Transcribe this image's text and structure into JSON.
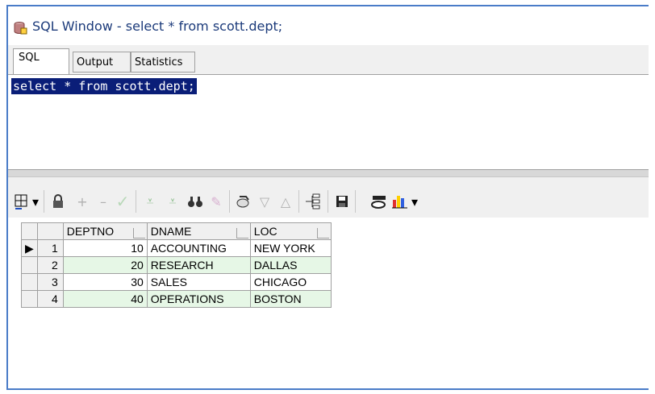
{
  "window": {
    "title": "SQL Window - select * from scott.dept;"
  },
  "tabs": [
    {
      "label": "SQL"
    },
    {
      "label": "Output"
    },
    {
      "label": "Statistics"
    }
  ],
  "editor": {
    "sql": "select * from scott.dept;"
  },
  "grid": {
    "columns": [
      "DEPTNO",
      "DNAME",
      "LOC"
    ],
    "rows": [
      {
        "num": "1",
        "deptno": "10",
        "dname": "ACCOUNTING",
        "loc": "NEW YORK",
        "current": true
      },
      {
        "num": "2",
        "deptno": "20",
        "dname": "RESEARCH",
        "loc": "DALLAS"
      },
      {
        "num": "3",
        "deptno": "30",
        "dname": "SALES",
        "loc": "CHICAGO"
      },
      {
        "num": "4",
        "deptno": "40",
        "dname": "OPERATIONS",
        "loc": "BOSTON"
      }
    ]
  },
  "toolbar": {
    "icons": [
      "grid-select-icon",
      "lock-icon",
      "add-record-icon",
      "delete-record-icon",
      "post-icon",
      "filter-icon",
      "clear-filter-icon",
      "find-icon",
      "clear-icon",
      "export-icon",
      "sort-descending-icon",
      "sort-ascending-icon",
      "tree-icon",
      "save-icon",
      "query-by-example-icon",
      "chart-icon"
    ]
  },
  "colors": {
    "selection": "#0a1e78",
    "alt_row": "#e6f7e6",
    "border": "#4a7cc8"
  }
}
